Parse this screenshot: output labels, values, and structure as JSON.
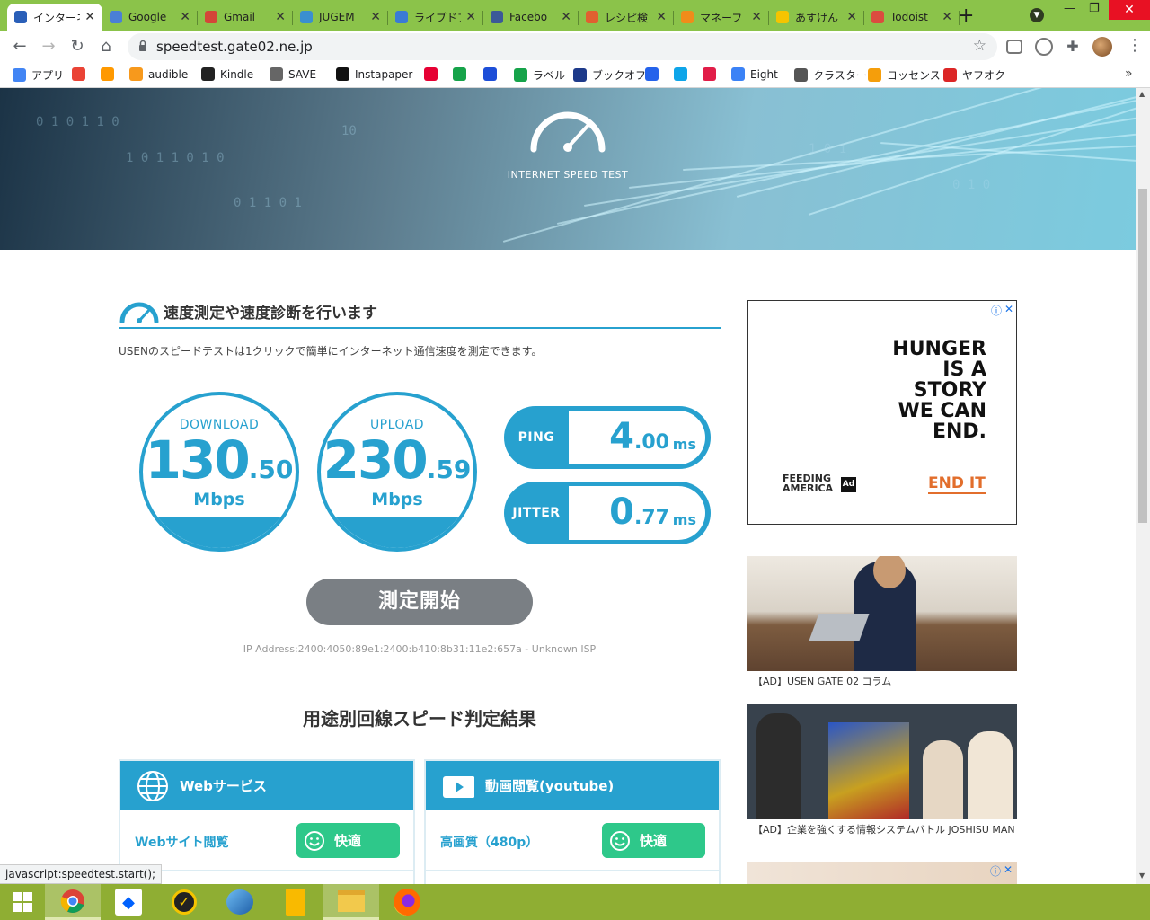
{
  "browser": {
    "tabs": [
      {
        "label": "インターネ",
        "color": "#2a5fb8",
        "active": true
      },
      {
        "label": "Google",
        "color": "#4a7fd6",
        "active": false
      },
      {
        "label": "Gmail",
        "color": "#d44638",
        "active": false
      },
      {
        "label": "JUGEM",
        "color": "#3a8fd0",
        "active": false
      },
      {
        "label": "ライブドア",
        "color": "#3a7bd5",
        "active": false
      },
      {
        "label": "Facebo",
        "color": "#3b5998",
        "active": false
      },
      {
        "label": "レシピ検",
        "color": "#e06030",
        "active": false
      },
      {
        "label": "マネーフ",
        "color": "#f08c1a",
        "active": false
      },
      {
        "label": "あすけん",
        "color": "#f5c400",
        "active": false
      },
      {
        "label": "Todoist",
        "color": "#db4c3f",
        "active": false
      }
    ],
    "tab_close": "✕",
    "new_tab": "+",
    "url": "speedtest.gate02.ne.jp",
    "bookmarks": [
      {
        "label": "アプリ",
        "color": "#4285f4"
      },
      {
        "label": "",
        "color": "#ea4335"
      },
      {
        "label": "",
        "color": "#ff9900"
      },
      {
        "label": "audible",
        "color": "#f7991c"
      },
      {
        "label": "Kindle",
        "color": "#222222"
      },
      {
        "label": "SAVE",
        "color": "#666666"
      },
      {
        "label": "Instapaper",
        "color": "#111111"
      },
      {
        "label": "",
        "color": "#e60033"
      },
      {
        "label": "",
        "color": "#16a34a"
      },
      {
        "label": "",
        "color": "#1d4ed8"
      },
      {
        "label": "ラベル",
        "color": "#16a34a"
      },
      {
        "label": "ブックオフ",
        "color": "#1e3a8a"
      },
      {
        "label": "",
        "color": "#2563eb"
      },
      {
        "label": "",
        "color": "#0ea5e9"
      },
      {
        "label": "",
        "color": "#e11d48"
      },
      {
        "label": "Eight",
        "color": "#3b82f6"
      },
      {
        "label": "クラスター",
        "color": "#555555"
      },
      {
        "label": "ヨッセンス",
        "color": "#f59e0b"
      },
      {
        "label": "ヤフオク",
        "color": "#dc2626"
      }
    ]
  },
  "hero": {
    "caption": "INTERNET SPEED TEST",
    "digits": [
      "0  1  0  1  1  0",
      "1 0 1 1 0 1 0",
      "0  1  1  0  1",
      "10",
      "1 0 1",
      "0 1  0"
    ]
  },
  "section": {
    "title": "速度測定や速度診断を行います",
    "lead": "USENのスピードテストは1クリックで簡単にインターネット通信速度を測定できます。"
  },
  "download": {
    "label": "DOWNLOAD",
    "int": "130",
    "dec": ".50",
    "unit": "Mbps"
  },
  "upload": {
    "label": "UPLOAD",
    "int": "230",
    "dec": ".59",
    "unit": "Mbps"
  },
  "ping": {
    "label": "PING",
    "int": "4",
    "dec": ".00",
    "unit": "ms"
  },
  "jitter": {
    "label": "JITTER",
    "int": "0",
    "dec": ".77",
    "unit": "ms"
  },
  "start_button": "測定開始",
  "ip_line": "IP Address:2400:4050:89e1:2400:b410:8b31:11e2:657a - Unknown ISP",
  "results_title": "用途別回線スピード判定結果",
  "cards": [
    {
      "title": "Webサービス",
      "row_label": "Webサイト閲覧",
      "status": "快適"
    },
    {
      "title": "動画閲覧(youtube)",
      "row_label": "高画質（480p）",
      "status": "快適"
    }
  ],
  "ad": {
    "headline": [
      "HUNGER",
      "IS A",
      "STORY",
      "WE CAN",
      "END."
    ],
    "brand_line1": "FEEDING",
    "brand_line2": "AMERICA",
    "ad_council": "Ad",
    "cta": "END IT",
    "info": "ⓘ",
    "close": "✕"
  },
  "thumbs": [
    {
      "caption": "【AD】USEN GATE 02 コラム"
    },
    {
      "caption": "【AD】企業を強くする情報システムバトル JOSHISU MAN"
    }
  ],
  "status_text": "javascript:speedtest.start();",
  "colors": {
    "accent": "#27a1cf",
    "ok": "#2ec88a",
    "button": "#7a7f84",
    "chrome": "#8bc34a"
  }
}
